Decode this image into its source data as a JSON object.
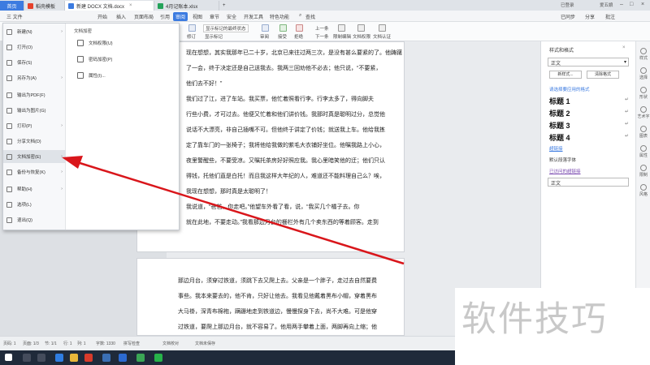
{
  "titlebar": {
    "home_tab": "首页",
    "tabs": [
      {
        "label": "稻壳模板"
      },
      {
        "label": "新建 DOCX 文档.docx"
      },
      {
        "label": "4月记账本.xlsx"
      }
    ],
    "login": "已登录",
    "user": "爱五娘"
  },
  "menubar": {
    "file": "三 文件",
    "items": [
      "开始",
      "插入",
      "页面布局",
      "引用",
      "审阅",
      "视图",
      "章节",
      "安全",
      "开发工具",
      "特色功能"
    ],
    "selected": "审阅",
    "search": "查找",
    "right_items": [
      "已同步",
      "分享",
      "批注"
    ]
  },
  "toolbar": {
    "items": [
      "修订",
      "显示标记的最终状态",
      "显示标记",
      "审阅",
      "接受",
      "拒绝",
      "上一条",
      "下一条",
      "限制编辑",
      "文档权限",
      "文档认证"
    ]
  },
  "filemenu": {
    "items": [
      {
        "label": "新建(N)",
        "arrow": true
      },
      {
        "label": "打开(O)",
        "arrow": false
      },
      {
        "label": "保存(S)",
        "arrow": false
      },
      {
        "label": "另存为(A)",
        "arrow": true
      },
      {
        "label": "输出为PDF(F)",
        "arrow": false
      },
      {
        "label": "输出为图片(G)",
        "arrow": false
      },
      {
        "label": "打印(P)",
        "arrow": true
      },
      {
        "label": "分享文档(D)",
        "arrow": false
      },
      {
        "label": "文档加密(E)",
        "arrow": true
      },
      {
        "label": "备份与恢复(K)",
        "arrow": true
      },
      {
        "label": "帮助(H)",
        "arrow": true
      },
      {
        "label": "选项(L)",
        "arrow": false
      },
      {
        "label": "退出(Q)",
        "arrow": false
      }
    ],
    "sub_title": "文档加密",
    "sub_items": [
      "文档权限(U)",
      "密码加密(P)",
      "属性(I)..."
    ]
  },
  "document": {
    "page1_lines": [
      "现在想想，其实我那年已二十岁，北京已来往过两三次，是没有甚么要紧的了。他踌躇",
      "了一会，终于决定还是自己送我去。我两三回劝他不必去；他只说，“不要紧，",
      "他们去不好！”",
      "我们过了江，进了车站。我买票，他忙着照看行李。行李太多了，得向脚夫",
      "行些小费，才可过去。他便又忙着和他们讲价钱。我那时真是聪明过分，总觉他",
      "说话不大漂亮，非自己插嘴不可。但他终于讲定了价钱；就送我上车。他给我拣",
      "定了靠车门的一张椅子；我将他给我做的紫毛大衣铺好坐位。他嘱我路上小心，",
      "夜里警醒些，不要受凉。又嘱托茶房好好照应我。我心里暗笑他的迂；他们只认",
      "得钱，托他们直是白托！而且我这样大年纪的人，难道还不能料理自己么？唉，",
      "我现在想想，那时真是太聪明了！",
      "我说道，“爸爸，你走吧。”他望车外看了看，说，“我买几个橘子去。你",
      "就在此地，不要走动。”我看那边月台的栅栏外有几个卖东西的等着顾客。走到"
    ],
    "page2_lines": [
      "那边月台，须穿过铁道，须跳下去又爬上去。父亲是一个胖子，走过去自然要费",
      "事些。我本来要去的，他不肯，只好让他去。我看见他戴着黑布小帽，穿着黑布",
      "大马褂，深青布棉袍，蹒跚地走到铁道边，慢慢探身下去，尚不大难。可是他穿",
      "过铁道，要爬上那边月台，就不容易了。他用两手攀着上面，两脚再向上缩；他"
    ]
  },
  "rightpanel": {
    "title": "样式和格式",
    "current": "正文",
    "buttons": [
      "新样式...",
      "清除格式"
    ],
    "hint": "请选择要应用的格式",
    "styles": [
      "标题 1",
      "标题 2",
      "标题 3",
      "标题 4"
    ],
    "more": [
      "超链接",
      "默认段落字体",
      "已访问的超链接"
    ],
    "bottom": "正文"
  },
  "rightstrip": [
    "样式",
    "选择",
    "形状",
    "艺术字",
    "图表",
    "属性",
    "限制",
    "风格"
  ],
  "statusbar": {
    "page": "页码: 1",
    "pages": "页面: 1/3",
    "section": "节: 1/1",
    "line": "行: 1",
    "col": "列: 1",
    "words": "字数: 1330",
    "spell": "拼写检查",
    "proof": "文档校对",
    "saved": "文档未保存"
  },
  "watermark": "软件技巧",
  "colors": {
    "accent": "#3c7be0",
    "arrow": "#d9161b"
  }
}
